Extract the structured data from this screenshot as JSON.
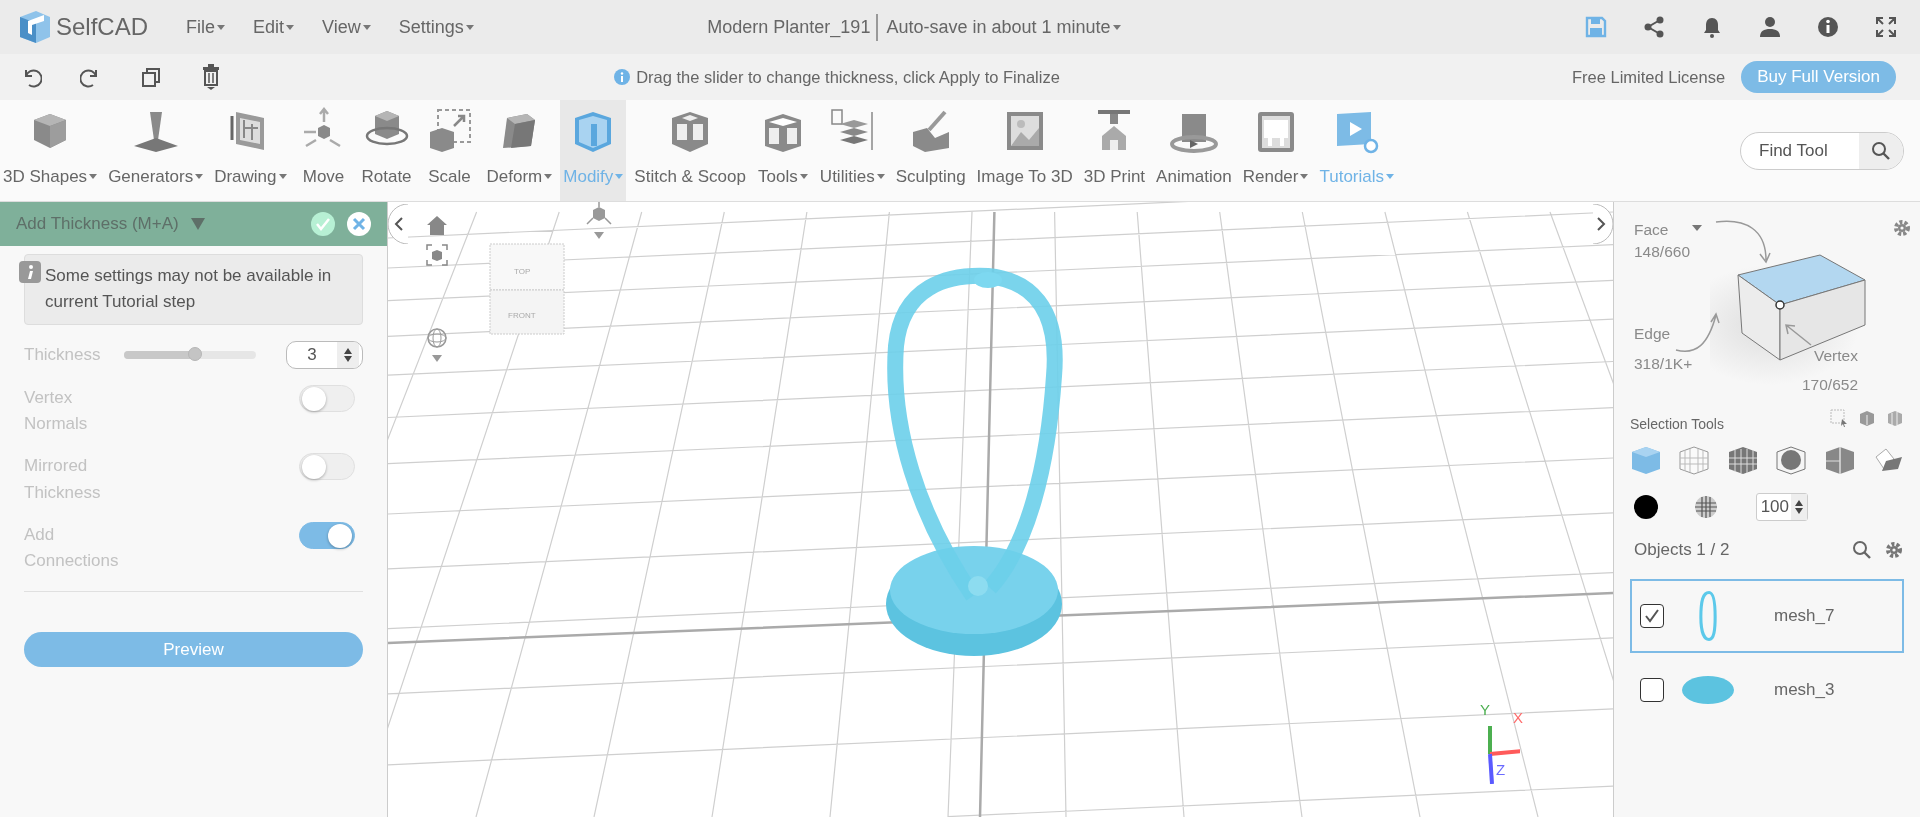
{
  "header": {
    "logo": "SelfCAD",
    "menus": [
      {
        "label": "File"
      },
      {
        "label": "Edit"
      },
      {
        "label": "View"
      },
      {
        "label": "Settings"
      }
    ],
    "document_title": "Modern Planter_191",
    "autosave": "Auto-save in about 1 minute"
  },
  "action_bar": {
    "hint": "Drag the slider to change thickness, click Apply to Finalize",
    "license": "Free Limited License",
    "buy_button": "Buy Full Version"
  },
  "toolbar": {
    "tools": [
      {
        "label": "3D Shapes",
        "dropdown": true,
        "selected": false,
        "highlighted": false
      },
      {
        "label": "Generators",
        "dropdown": true,
        "selected": false,
        "highlighted": false
      },
      {
        "label": "Drawing",
        "dropdown": true,
        "selected": false,
        "highlighted": false
      },
      {
        "label": "Move",
        "dropdown": false,
        "selected": false,
        "highlighted": false
      },
      {
        "label": "Rotate",
        "dropdown": false,
        "selected": false,
        "highlighted": false
      },
      {
        "label": "Scale",
        "dropdown": false,
        "selected": false,
        "highlighted": false
      },
      {
        "label": "Deform",
        "dropdown": true,
        "selected": false,
        "highlighted": false
      },
      {
        "label": "Modify",
        "dropdown": true,
        "selected": true,
        "highlighted": true
      },
      {
        "label": "Stitch & Scoop",
        "dropdown": false,
        "selected": false,
        "highlighted": false
      },
      {
        "label": "Tools",
        "dropdown": true,
        "selected": false,
        "highlighted": false
      },
      {
        "label": "Utilities",
        "dropdown": true,
        "selected": false,
        "highlighted": false
      },
      {
        "label": "Sculpting",
        "dropdown": false,
        "selected": false,
        "highlighted": false
      },
      {
        "label": "Image To 3D",
        "dropdown": false,
        "selected": false,
        "highlighted": false
      },
      {
        "label": "3D Print",
        "dropdown": false,
        "selected": false,
        "highlighted": false
      },
      {
        "label": "Animation",
        "dropdown": false,
        "selected": false,
        "highlighted": false
      },
      {
        "label": "Render",
        "dropdown": true,
        "selected": false,
        "highlighted": false
      },
      {
        "label": "Tutorials",
        "dropdown": true,
        "selected": false,
        "highlighted": true
      }
    ],
    "search": {
      "placeholder": "Find Tool"
    }
  },
  "tool_panel": {
    "title": "Add Thickness (M+A)",
    "notice": "Some settings may not be available in current Tutorial step",
    "thickness": {
      "label": "Thickness",
      "level": 0.54,
      "value": "3"
    },
    "toggles": [
      {
        "label": "Vertex Normals",
        "on": false
      },
      {
        "label": "Mirrored Thickness",
        "on": false
      },
      {
        "label": "Add Connections",
        "on": true
      }
    ],
    "preview_button": "Preview"
  },
  "viewport": {
    "view_cube": {
      "top": "TOP",
      "front": "FRONT"
    },
    "axes": [
      {
        "label": "Y"
      },
      {
        "label": "X"
      },
      {
        "label": "Z"
      }
    ]
  },
  "right_panel": {
    "face": {
      "label": "Face",
      "count": "148/660"
    },
    "edge": {
      "label": "Edge",
      "count": "318/1K+"
    },
    "vertex": {
      "label": "Vertex",
      "count": "170/652"
    },
    "selection_tools_label": "Selection Tools",
    "selection_modes": [
      {
        "selected": true
      },
      {
        "selected": false
      },
      {
        "selected": false
      },
      {
        "selected": false
      },
      {
        "selected": false
      },
      {
        "selected": false
      }
    ],
    "opacity": "100",
    "objects_label": "Objects 1 / 2",
    "objects": [
      {
        "name": "mesh_7",
        "checked": true,
        "selected": true
      },
      {
        "name": "mesh_3",
        "checked": false,
        "selected": false
      }
    ]
  }
}
